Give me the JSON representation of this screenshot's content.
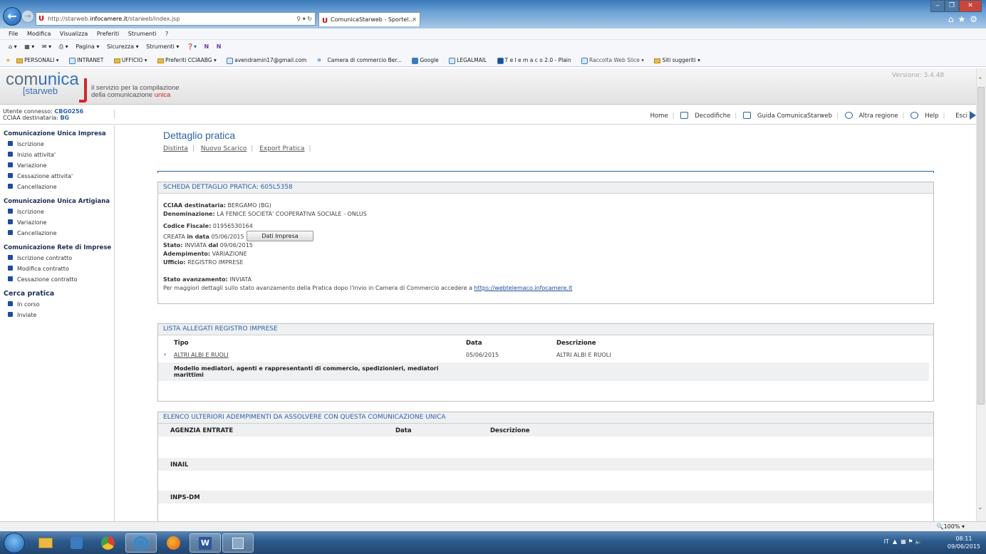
{
  "browser": {
    "url_prefix": "http://starweb.",
    "url_domain": "infocamere.it",
    "url_path": "/starweb/index.jsp",
    "tab_title": "ComunicaStarweb - Sportel...",
    "menu": [
      "File",
      "Modifica",
      "Visualizza",
      "Preferiti",
      "Strumenti",
      "?"
    ],
    "commands": [
      "Pagina ▾",
      "Sicurezza ▾",
      "Strumenti ▾"
    ],
    "favorites": [
      "PERSONALI ▾",
      "INTRANET",
      "UFFICIO ▾",
      "Preferiti CCIAABG ▾",
      "avendramin17@gmail.com",
      "Camera di commercio Ber...",
      "Google",
      "LEGALMAIL",
      "T e l e m a c o 2.0 - Plain",
      "Raccolta Web Slice ▾",
      "Siti suggeriti ▾"
    ],
    "zoom": "100%"
  },
  "app": {
    "logo_main_a": "com",
    "logo_main_b": "unica",
    "logo_sub": "starweb",
    "tagline_1": "il servizio per la compilazione",
    "tagline_2a": "della comunicazione ",
    "tagline_2b": "unica",
    "version": "Versione: 3.4.48",
    "user_label": "Utente connesso:",
    "user_value": "CBG0256",
    "cciaa_label": "CCIAA destinataria:",
    "cciaa_value": "BG",
    "topnav": [
      "Home",
      "Decodifiche",
      "Guida ComunicaStarweb",
      "Altra regione",
      "Help",
      "Esci"
    ]
  },
  "sidebar": {
    "groups": [
      {
        "title": "Comunicazione Unica Impresa",
        "items": [
          "Iscrizione",
          "Inizio attivita'",
          "Variazione",
          "Cessazione attivita'",
          "Cancellazione"
        ]
      },
      {
        "title": "Comunicazione Unica Artigiana",
        "items": [
          "Iscrizione",
          "Variazione",
          "Cancellazione"
        ]
      },
      {
        "title": "Comunicazione Rete di Imprese",
        "items": [
          "Iscrizione contratto",
          "Modifica contratto",
          "Cessazione contratto"
        ]
      },
      {
        "title": "Cerca pratica",
        "items": [
          "In corso",
          "Inviate"
        ]
      }
    ]
  },
  "page": {
    "title": "Dettaglio pratica",
    "links": [
      "Distinta",
      "Nuovo Scarico",
      "Export Pratica"
    ]
  },
  "scheda": {
    "header": "SCHEDA DETTAGLIO PRATICA: 605L5358",
    "cciaa_label": "CCIAA destinataria:",
    "cciaa_value": "BERGAMO (BG)",
    "denom_label": "Denominazione:",
    "denom_value": "LA FENICE SOCIETA' COOPERATIVA SOCIALE - ONLUS",
    "cf_label": "Codice Fiscale:",
    "cf_value": "01956530164",
    "dati_button": "Dati Impresa",
    "creata_a": "CREATA",
    "creata_b": "in data",
    "creata_c": "05/06/2015",
    "stato_label": "Stato:",
    "stato_a": "INVIATA",
    "stato_b": "dal",
    "stato_c": "09/06/2015",
    "adempimento_label": "Adempimento:",
    "adempimento_value": "VARIAZIONE",
    "ufficio_label": "Ufficio:",
    "ufficio_value": "REGISTRO IMPRESE",
    "avanz_label": "Stato avanzamento:",
    "avanz_value": "INVIATA",
    "info_text": "Per maggiori dettagli sullo stato avanzamento della Pratica dopo l'invio in Camera di Commercio accedere a",
    "info_link": "https://webtelemaco.infocamere.it"
  },
  "allegati": {
    "header": "LISTA ALLEGATI REGISTRO IMPRESE",
    "columns": [
      "Tipo",
      "Data",
      "Descrizione"
    ],
    "row": {
      "tipo": "ALTRI ALBI E RUOLI",
      "data": "05/06/2015",
      "descrizione": "ALTRI ALBI E RUOLI"
    },
    "sub_1": "Modello mediatori, agenti e rappresentanti di commercio, spedizionieri, mediatori",
    "sub_2": "marittimi"
  },
  "adempimenti": {
    "header": "ELENCO ULTERIORI ADEMPIMENTI DA ASSOLVERE CON QUESTA COMUNICAZIONE UNICA",
    "sections": [
      "AGENZIA ENTRATE",
      "INAIL",
      "INPS-DM"
    ],
    "columns": [
      "Data",
      "Descrizione"
    ]
  },
  "taskbar": {
    "lang": "IT",
    "time": "08:11",
    "date": "09/06/2015"
  }
}
